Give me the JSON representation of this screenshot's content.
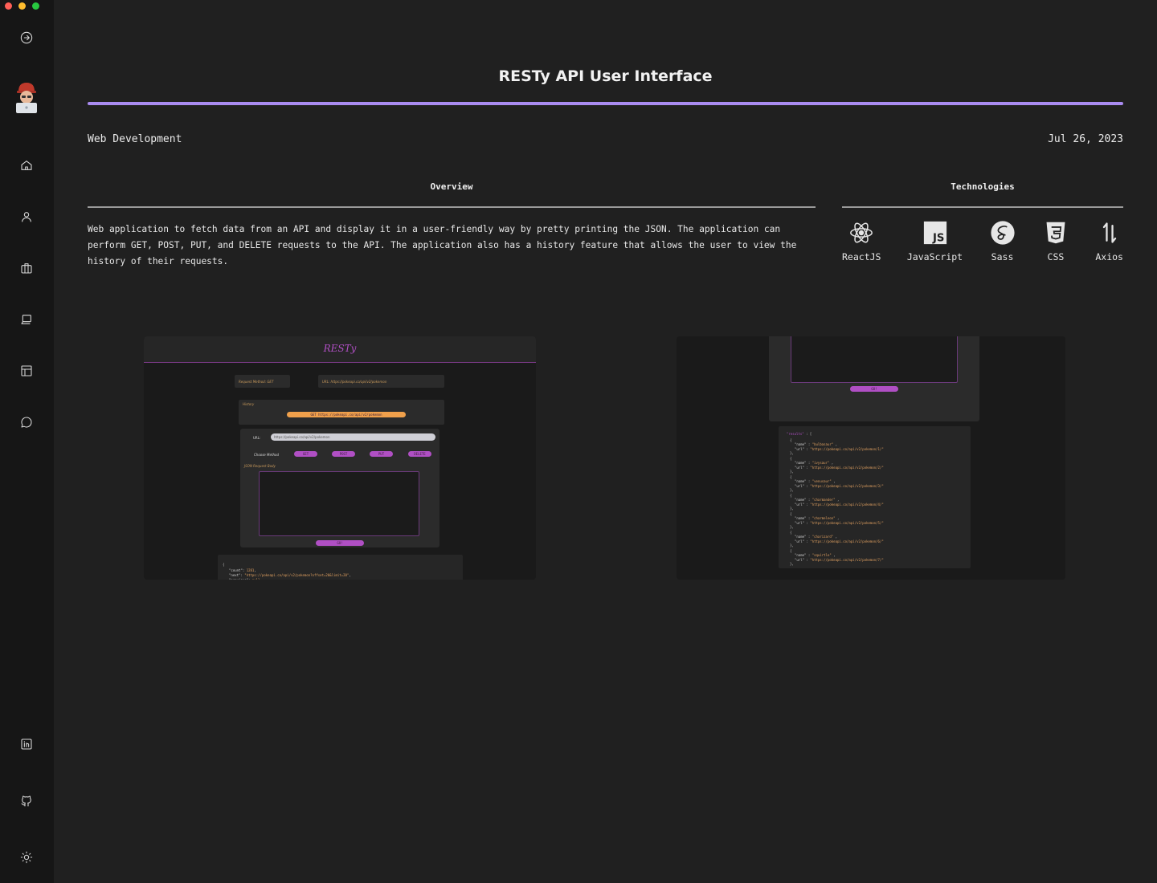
{
  "window": {
    "dot_colors": [
      "#ff5f57",
      "#febc2e",
      "#28c840"
    ]
  },
  "sidebar": {
    "items": [
      {
        "name": "logout-icon"
      },
      {
        "name": "home-icon"
      },
      {
        "name": "user-icon"
      },
      {
        "name": "briefcase-icon"
      },
      {
        "name": "laptop-icon"
      },
      {
        "name": "layout-icon"
      },
      {
        "name": "chat-icon"
      },
      {
        "name": "linkedin-icon"
      },
      {
        "name": "github-icon"
      },
      {
        "name": "sun-icon"
      }
    ]
  },
  "project": {
    "title": "RESTy API User Interface",
    "category": "Web Development",
    "date": "Jul 26, 2023",
    "accent_color": "#a98bf0"
  },
  "overview": {
    "heading": "Overview",
    "text": "Web application to fetch data from an API and display it in a user-friendly way by pretty printing the JSON. The application can perform GET, POST, PUT, and DELETE requests to the API. The application also has a history feature that allows the user to view the history of their requests."
  },
  "technologies": {
    "heading": "Technologies",
    "items": [
      {
        "label": "ReactJS",
        "icon": "react-icon"
      },
      {
        "label": "JavaScript",
        "icon": "javascript-icon"
      },
      {
        "label": "Sass",
        "icon": "sass-icon"
      },
      {
        "label": "CSS",
        "icon": "css3-icon"
      },
      {
        "label": "Axios",
        "icon": "axios-icon"
      }
    ]
  },
  "screenshots": {
    "left": {
      "app_title": "RESTy",
      "request_method": "Request Method: GET",
      "url_label": "URL: https://pokeapi.co/api/v2/pokemon",
      "history_label": "History",
      "history_item": "GET https://pokeapi.co/api/v2/pokemon",
      "url_field_label": "URL:",
      "url_field_value": "https://pokeapi.co/api/v2/pokemon",
      "choose_method": "Choose Method",
      "methods": [
        "GET",
        "POST",
        "PUT",
        "DELETE"
      ],
      "json_body_label": "JSON Request Body",
      "go_button": "GO!",
      "colors": {
        "accent": "#b04fc4",
        "history": "#f0a04b"
      }
    },
    "right": {
      "go_button": "GO!",
      "names": [
        "bulbasaur",
        "ivysaur",
        "venusaur",
        "charmander",
        "charmeleon",
        "charizard",
        "squirtle"
      ]
    }
  }
}
